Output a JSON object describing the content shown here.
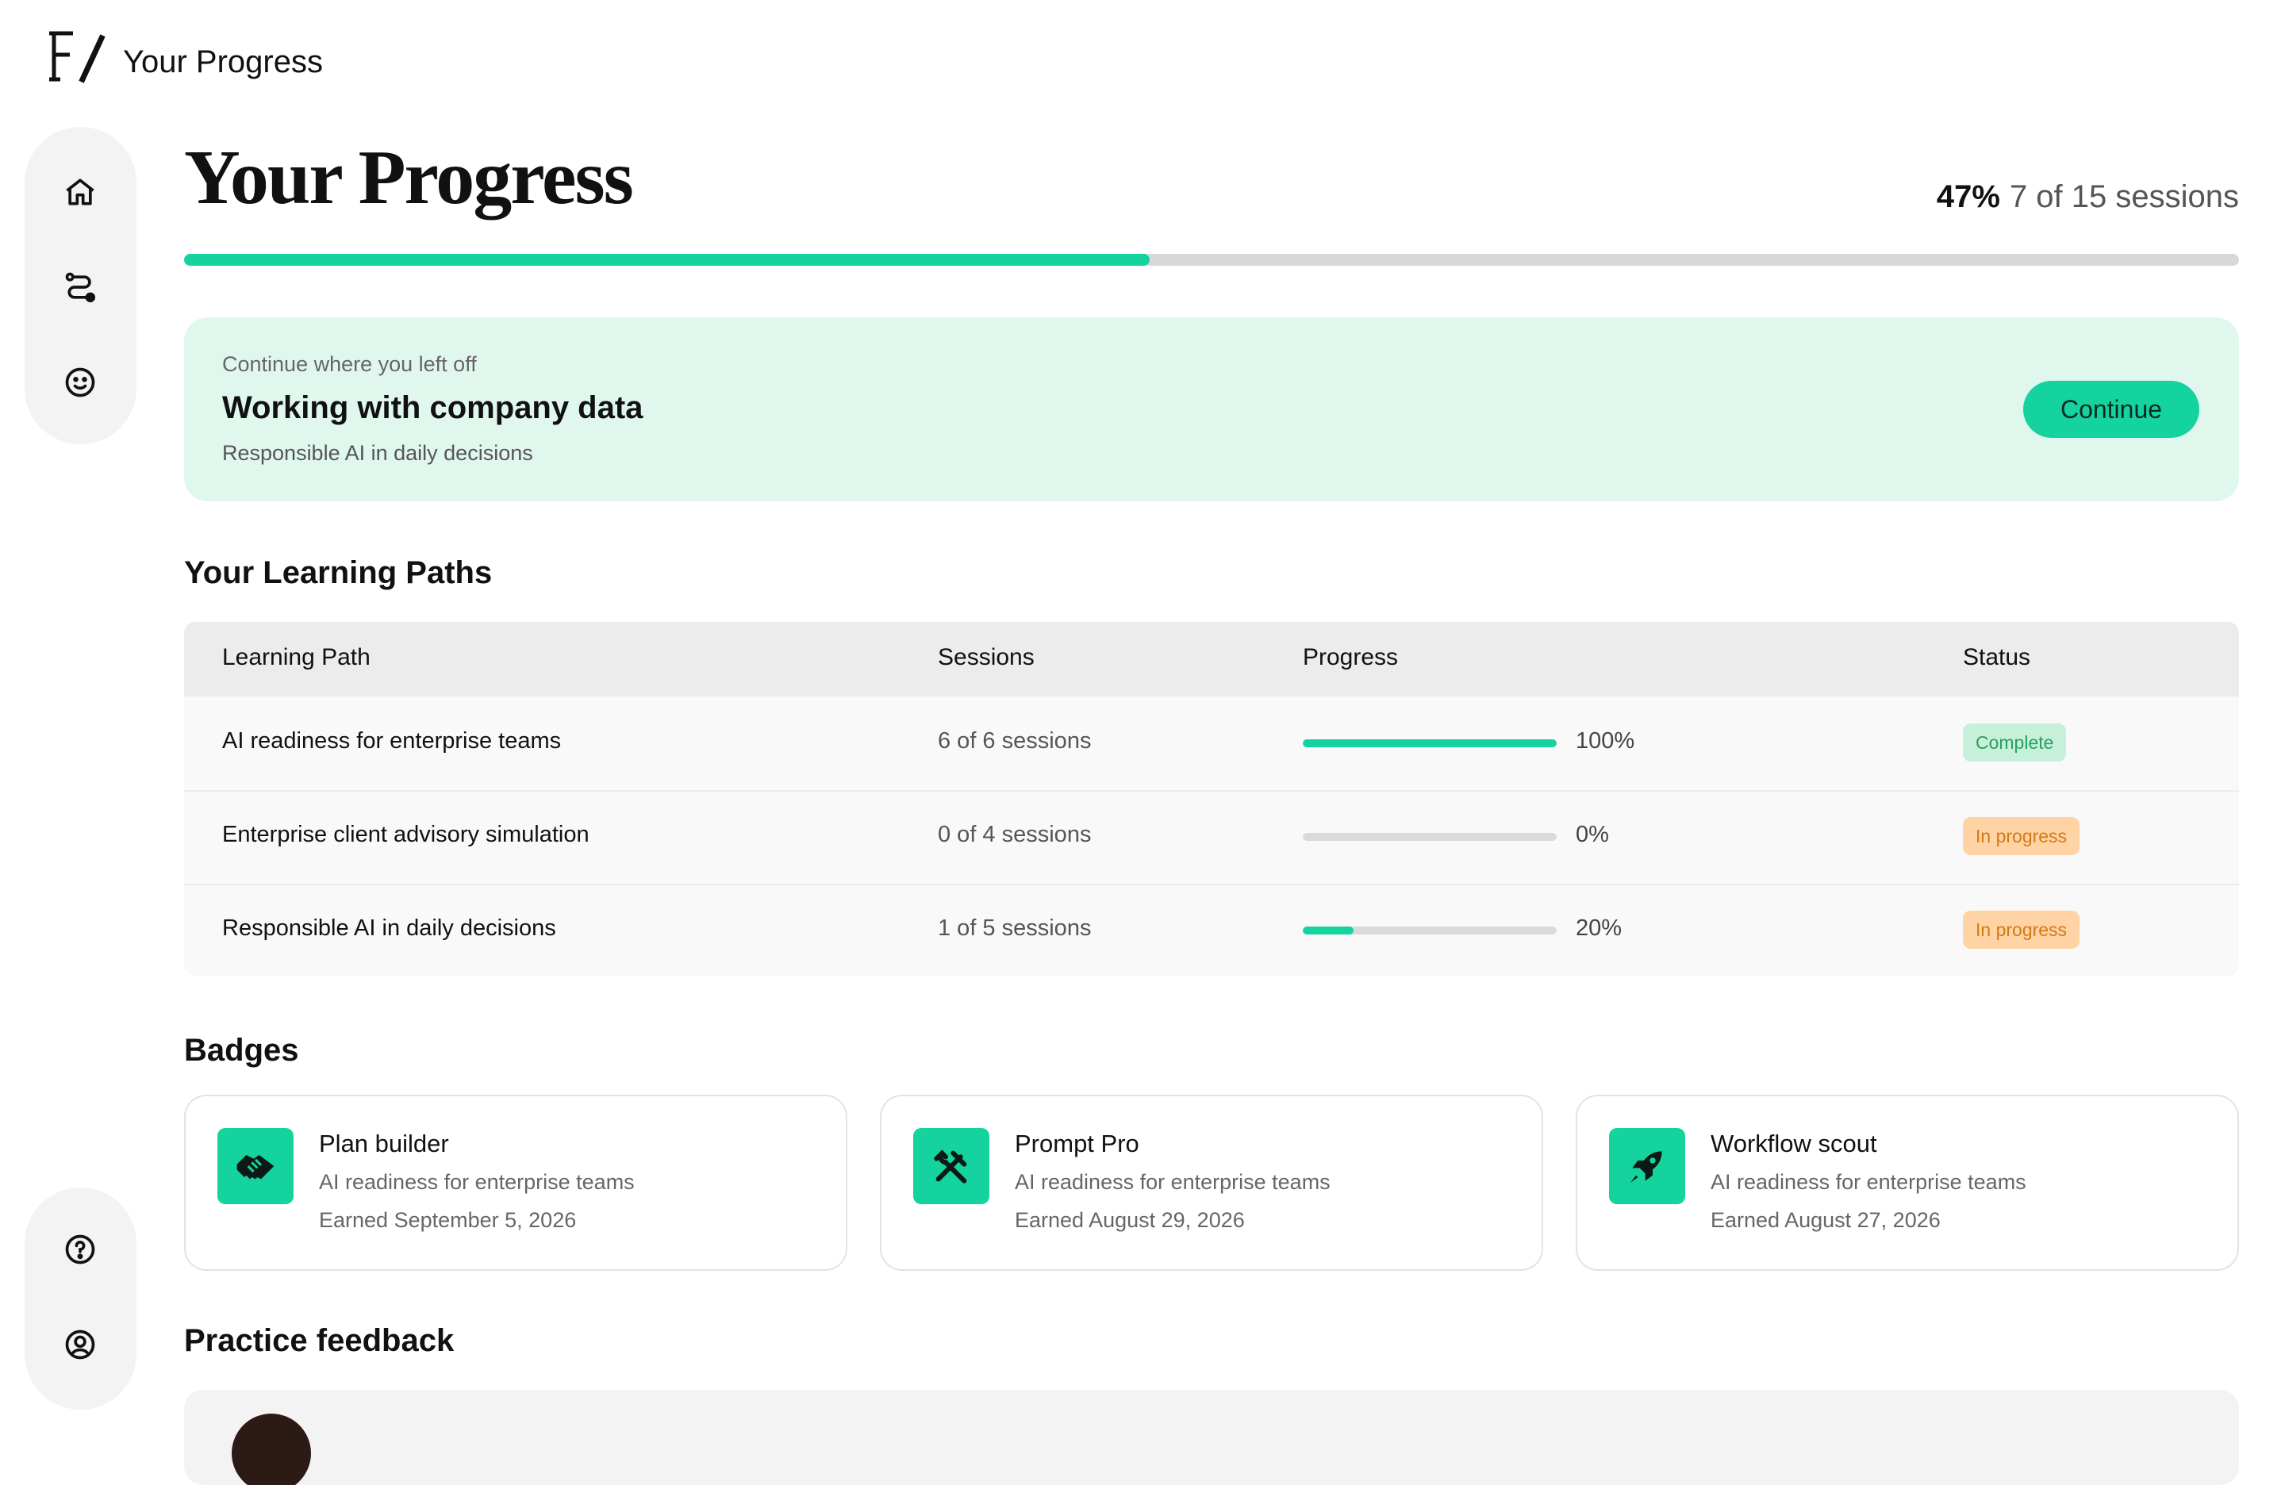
{
  "header": {
    "app_title": "Your Progress",
    "logo_icon": "brand-logo-icon"
  },
  "nav": {
    "top_items": [
      {
        "name": "home",
        "icon": "home-icon"
      },
      {
        "name": "paths",
        "icon": "route-icon"
      },
      {
        "name": "feedback",
        "icon": "smiley-icon"
      }
    ],
    "bottom_items": [
      {
        "name": "help",
        "icon": "help-icon"
      },
      {
        "name": "account",
        "icon": "user-icon"
      }
    ]
  },
  "page": {
    "title": "Your Progress",
    "overall_percent_label": "47%",
    "overall_sessions_label": "7 of 15 sessions",
    "overall_fraction": 0.47,
    "accent_color": "#14d39e"
  },
  "resume": {
    "eyebrow": "Continue where you left off",
    "title": "Working with company data",
    "subtitle": "Responsible AI in daily decisions",
    "button_label": "Continue"
  },
  "paths": {
    "section_title": "Your Learning Paths",
    "columns": [
      "Learning Path",
      "Sessions",
      "Progress",
      "Status"
    ],
    "rows": [
      {
        "name": "AI readiness for enterprise teams",
        "sessions": "6 of 6 sessions",
        "progress": 1.0,
        "progress_label": "100%",
        "status": "Complete",
        "status_kind": "complete"
      },
      {
        "name": "Enterprise client advisory simulation",
        "sessions": "0 of 4 sessions",
        "progress": 0.0,
        "progress_label": "0%",
        "status": "In progress",
        "status_kind": "progress"
      },
      {
        "name": "Responsible AI in daily decisions",
        "sessions": "1 of 5 sessions",
        "progress": 0.2,
        "progress_label": "20%",
        "status": "In progress",
        "status_kind": "progress"
      }
    ]
  },
  "badges": {
    "section_title": "Badges",
    "items": [
      {
        "name": "Plan builder",
        "path": "AI readiness for enterprise teams",
        "earned": "Earned September 5, 2026",
        "icon": "handshake-icon"
      },
      {
        "name": "Prompt Pro",
        "path": "AI readiness for enterprise teams",
        "earned": "Earned August 29, 2026",
        "icon": "tools-icon"
      },
      {
        "name": "Workflow scout",
        "path": "AI readiness for enterprise teams",
        "earned": "Earned August 27, 2026",
        "icon": "rocket-icon"
      }
    ]
  },
  "feedback": {
    "section_title": "Practice feedback"
  }
}
